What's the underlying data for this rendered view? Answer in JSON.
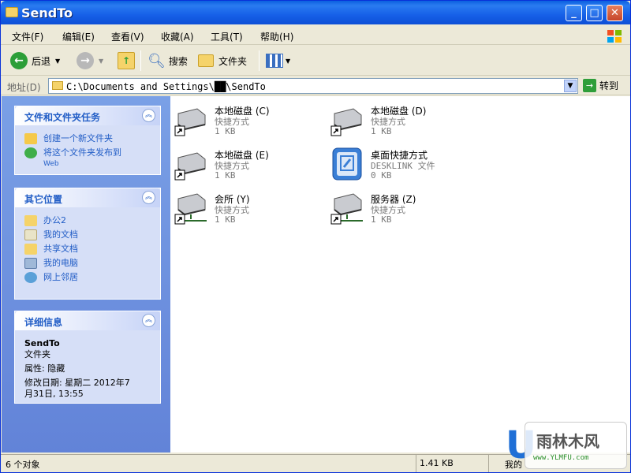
{
  "window": {
    "title": "SendTo"
  },
  "menu": [
    "文件(F)",
    "编辑(E)",
    "查看(V)",
    "收藏(A)",
    "工具(T)",
    "帮助(H)"
  ],
  "toolbar": {
    "back": "后退",
    "search": "搜索",
    "folders": "文件夹"
  },
  "address": {
    "label": "地址(D)",
    "path": "C:\\Documents and Settings\\██\\SendTo",
    "go": "转到"
  },
  "tasks": {
    "title": "文件和文件夹任务",
    "items": [
      "创建一个新文件夹",
      "将这个文件夹发布到",
      "Web"
    ]
  },
  "places": {
    "title": "其它位置",
    "items": [
      "办公2",
      "我的文档",
      "共享文档",
      "我的电脑",
      "网上邻居"
    ]
  },
  "details": {
    "title": "详细信息",
    "name": "SendTo",
    "type": "文件夹",
    "attr": "属性: 隐藏",
    "date1": "修改日期: 星期二 2012年7",
    "date2": "月31日, 13:55"
  },
  "files": [
    {
      "name": "本地磁盘 (C)",
      "type": "快捷方式",
      "size": "1 KB"
    },
    {
      "name": "本地磁盘 (D)",
      "type": "快捷方式",
      "size": "1 KB"
    },
    {
      "name": "本地磁盘 (E)",
      "type": "快捷方式",
      "size": "1 KB"
    },
    {
      "name": "桌面快捷方式",
      "type": "DESKLINK 文件",
      "size": "0 KB"
    },
    {
      "name": "会所 (Y)",
      "type": "快捷方式",
      "size": "1 KB"
    },
    {
      "name": "服务器 (Z)",
      "type": "快捷方式",
      "size": "1 KB"
    }
  ],
  "status": {
    "count": "6 个对象",
    "size": "1.41 KB",
    "location": "我的"
  },
  "watermark": {
    "brand": "雨林木风",
    "url": "www.YLMFU.com"
  }
}
